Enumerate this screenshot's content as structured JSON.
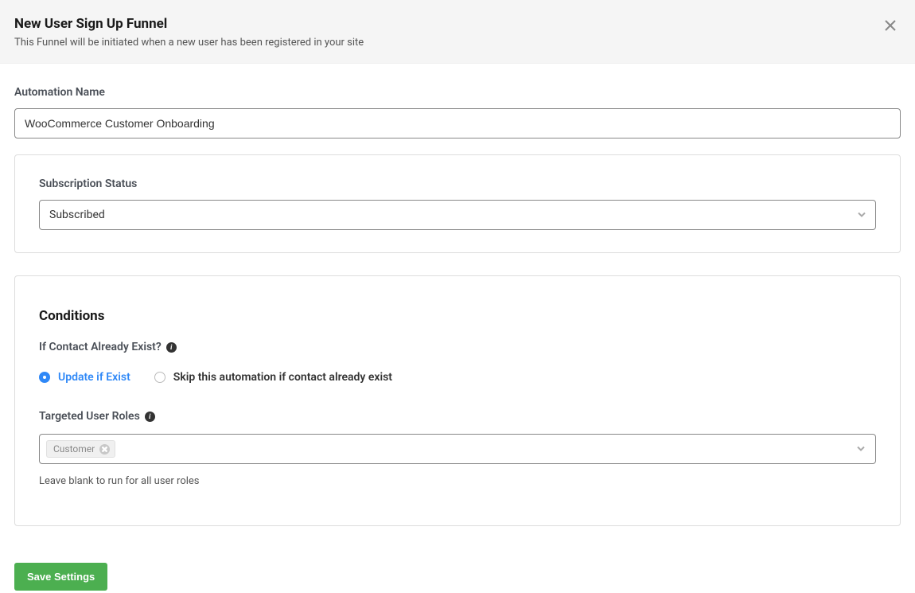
{
  "header": {
    "title": "New User Sign Up Funnel",
    "subtitle": "This Funnel will be initiated when a new user has been registered in your site"
  },
  "automation_name": {
    "label": "Automation Name",
    "value": "WooCommerce Customer Onboarding"
  },
  "subscription_status": {
    "label": "Subscription Status",
    "value": "Subscribed"
  },
  "conditions": {
    "title": "Conditions",
    "already_exist_label": "If Contact Already Exist?",
    "radios": {
      "update": "Update if Exist",
      "skip": "Skip this automation if contact already exist"
    },
    "roles_label": "Targeted User Roles",
    "roles_tag": "Customer",
    "roles_helper": "Leave blank to run for all user roles"
  },
  "footer": {
    "save_label": "Save Settings"
  }
}
